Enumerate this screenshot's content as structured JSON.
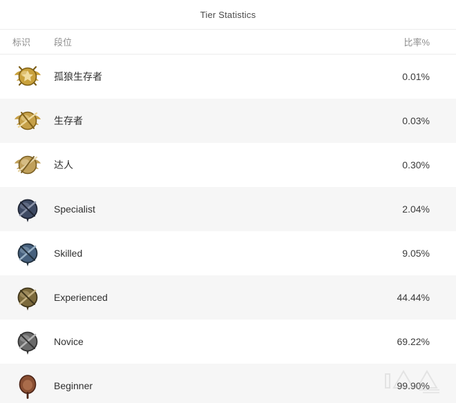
{
  "header": {
    "title": "Tier Statistics"
  },
  "table": {
    "columns": [
      {
        "key": "badge",
        "label": "标识"
      },
      {
        "key": "tier",
        "label": "段位"
      },
      {
        "key": "rate",
        "label": "比率%"
      }
    ],
    "rows": [
      {
        "tier": "孤狼生存者",
        "rate": "0.01%",
        "badge": "gold-winged-emblem-icon",
        "colors": {
          "main": "#c9a13b",
          "dark": "#7d5f16",
          "light": "#f0dca0"
        }
      },
      {
        "tier": "生存者",
        "rate": "0.03%",
        "badge": "gold-wreath-emblem-icon",
        "colors": {
          "main": "#c6a048",
          "dark": "#806019",
          "light": "#edd79a"
        }
      },
      {
        "tier": "达人",
        "rate": "0.30%",
        "badge": "gold-disc-emblem-icon",
        "colors": {
          "main": "#c0a05a",
          "dark": "#7a5f24",
          "light": "#e6d4a6"
        }
      },
      {
        "tier": "Specialist",
        "rate": "2.04%",
        "badge": "navy-disc-emblem-icon",
        "colors": {
          "main": "#3e4a63",
          "dark": "#1f2534",
          "light": "#8a93a8"
        }
      },
      {
        "tier": "Skilled",
        "rate": "9.05%",
        "badge": "steel-blue-disc-emblem-icon",
        "colors": {
          "main": "#46607d",
          "dark": "#22313f",
          "light": "#9ab2c6"
        }
      },
      {
        "tier": "Experienced",
        "rate": "44.44%",
        "badge": "olive-bronze-disc-emblem-icon",
        "colors": {
          "main": "#7c6a3c",
          "dark": "#40361b",
          "light": "#c5b283"
        }
      },
      {
        "tier": "Novice",
        "rate": "69.22%",
        "badge": "gunmetal-disc-emblem-icon",
        "colors": {
          "main": "#6a6a6a",
          "dark": "#343434",
          "light": "#b5b5b5"
        }
      },
      {
        "tier": "Beginner",
        "rate": "99.90%",
        "badge": "copper-oval-emblem-icon",
        "colors": {
          "main": "#8a4f33",
          "dark": "#4a2316",
          "light": "#c98a64"
        }
      }
    ]
  },
  "watermark": {
    "name": "site-watermark-icon"
  },
  "style_tokens": {
    "row_background": "#ffffff",
    "row_background_alt": "#f6f6f6",
    "title_color": "#4a4a4a",
    "header_text_color": "#8d8d8d",
    "tier_text_color": "#2f2f2f",
    "rate_text_color": "#3a3a3a",
    "divider_color": "#ececec"
  }
}
